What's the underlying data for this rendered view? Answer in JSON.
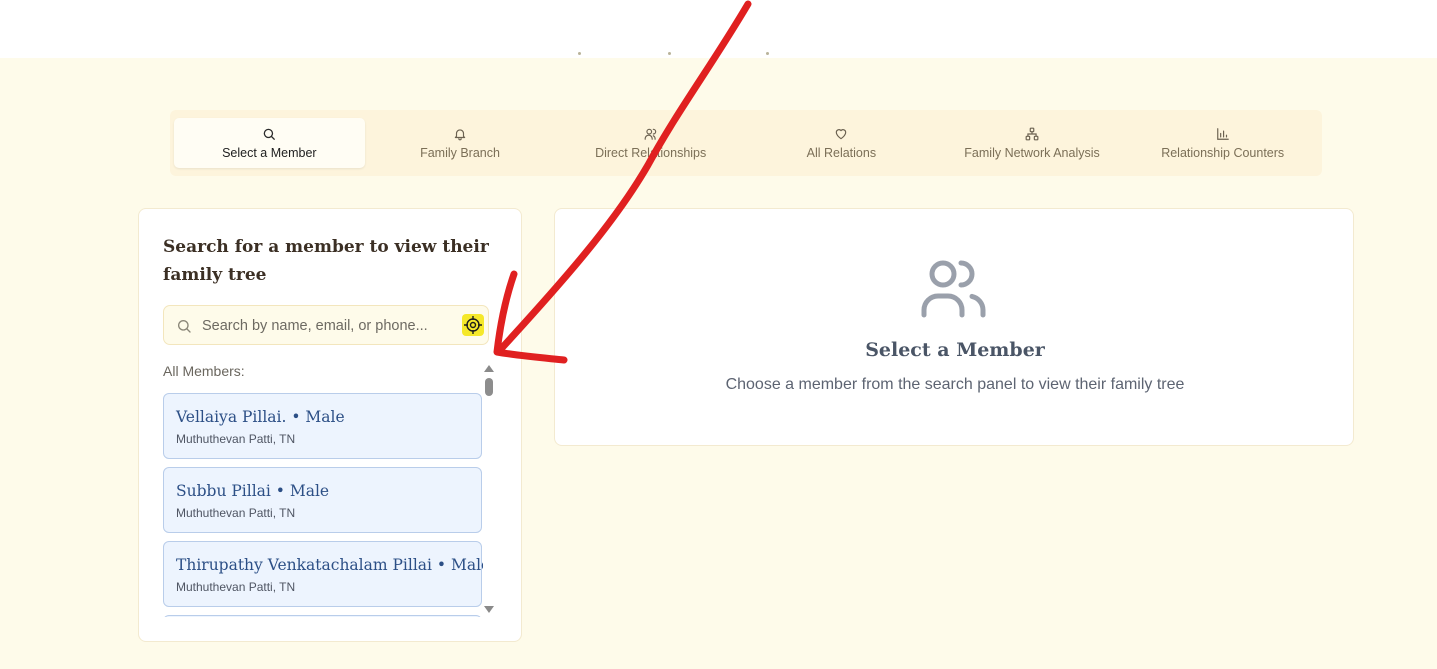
{
  "tabs": [
    {
      "label": "Select a Member",
      "icon": "search-icon",
      "active": true
    },
    {
      "label": "Family Branch",
      "icon": "bell-icon",
      "active": false
    },
    {
      "label": "Direct Relationships",
      "icon": "users-icon",
      "active": false
    },
    {
      "label": "All Relations",
      "icon": "heart-icon",
      "active": false
    },
    {
      "label": "Family Network Analysis",
      "icon": "network-icon",
      "active": false
    },
    {
      "label": "Relationship Counters",
      "icon": "bar-chart-icon",
      "active": false
    }
  ],
  "search_panel": {
    "title": "Search for a member to view their family tree",
    "search_placeholder": "Search by name, email, or phone...",
    "members_label": "All Members:",
    "members": [
      {
        "name": "Vellaiya Pillai. • Male",
        "location": "Muthuthevan Patti, TN"
      },
      {
        "name": "Subbu Pillai • Male",
        "location": "Muthuthevan Patti, TN"
      },
      {
        "name": "Thirupathy Venkatachalam Pillai • Male",
        "location": "Muthuthevan Patti, TN"
      }
    ]
  },
  "empty_state": {
    "icon": "users-icon",
    "title": "Select a Member",
    "subtitle": "Choose a member from the search panel to view their family tree"
  },
  "colors": {
    "background": "#fefbea",
    "tab_bar": "#fdf4dc",
    "card_bg": "#edf4fe",
    "card_border": "#b9cdea",
    "card_name": "#2c4f86",
    "target_button": "#f5e82a",
    "annotation_arrow": "#e02020"
  }
}
